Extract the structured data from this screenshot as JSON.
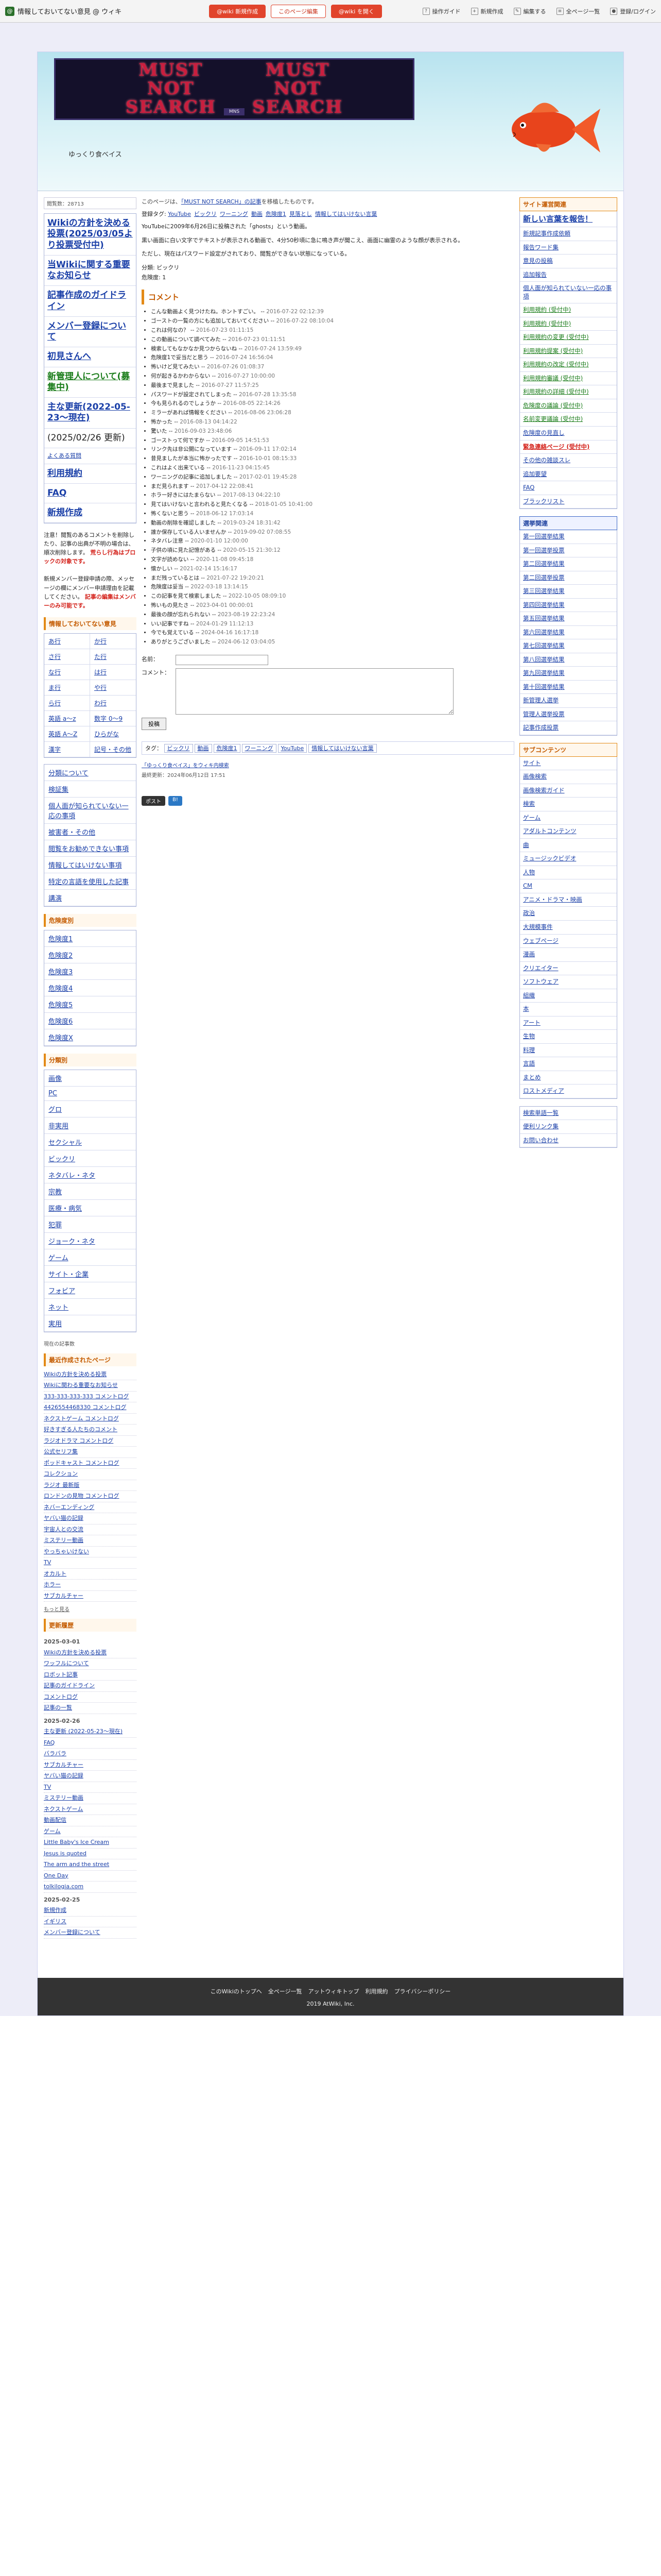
{
  "topbar": {
    "site": "情報しておいてない意見 @ ウィキ",
    "pill1": "@wiki 新規作成",
    "pill2": "このページ編集",
    "pill3": "@wiki を開く",
    "tools": [
      "操作ガイド",
      "新規作成",
      "編集する",
      "全ページ一覧",
      "登録/ログイン"
    ]
  },
  "header": {
    "banner_word1": "MUST\nNOT\nSEARCH",
    "banner_word2": "MUST\nNOT\nSEARCH",
    "banner_badge": "MNS",
    "site_title": "ゆっくり食べイス"
  },
  "left": {
    "views": "閲覧数：28713",
    "bigmenu": [
      "Wikiの方針を決める投票(2025/03/05より投票受付中)",
      "当Wikiに関する重要なお知らせ",
      "記事作成のガイドライン",
      "メンバー登録について",
      "初見さんへ",
      "新管理人について(募集中)",
      "主な更新(2022-05-23〜現在)"
    ],
    "updated": "(2025/02/26 更新)",
    "meta_links": [
      "よくある質問",
      "利用規約",
      "FAQ",
      "新規作成"
    ],
    "notice_a": "注意！閲覧のあるコメントを削除したり、記事の出典が不明の場合は、順次削除します。",
    "notice_warn": "荒らし行為はブロックの対象です。",
    "notice_b": "新規メンバー登録申請の際、メッセージの欄にメンバー申請理由を記載してください。",
    "red_note": "記事の編集はメンバーのみ可能です。",
    "sec_head_1": "情報しておいてない意見",
    "grid": [
      "あ行",
      "か行",
      "さ行",
      "た行",
      "な行",
      "は行",
      "ま行",
      "や行",
      "ら行",
      "わ行",
      "英語 a〜z",
      "数字 0〜9",
      "英語 A〜Z",
      "ひらがな",
      "漢字",
      "記号・その他"
    ],
    "box2": [
      "分類について",
      "検証集",
      "個人面が知られていない一応の事項",
      "被害者・その他",
      "閲覧をお勧めできない事項",
      "情報してはいけない事項",
      "特定の言語を使用した記事",
      "講演"
    ],
    "sec_head_2": "危険度別",
    "danger": [
      "危険度1",
      "危険度2",
      "危険度3",
      "危険度4",
      "危険度5",
      "危険度6",
      "危険度X"
    ],
    "sec_head_3": "分類別",
    "categories": [
      "画像",
      "PC",
      "グロ",
      "非実用",
      "セクシャル",
      "ビックリ",
      "ネタバレ・ネタ",
      "宗教",
      "医療・病気",
      "犯罪",
      "ジョーク・ネタ",
      "ゲーム",
      "サイト・企業",
      "フォビア",
      "ネット",
      "実用"
    ],
    "count": "現在の記事数",
    "sec_head_4": "最近作成されたページ",
    "recent": [
      {
        "t": "Wikiの方針を決める投票"
      },
      {
        "t": "Wikiに関わる重要なお知らせ"
      },
      {
        "t": "333-333-333-333 コメントログ"
      },
      {
        "t": "4426554468330 コメントログ"
      },
      {
        "t": "ネクストゲーム コメントログ"
      },
      {
        "t": "好きすぎる人たちのコメント"
      },
      {
        "t": "ラジオドラマ コメントログ"
      },
      {
        "t": "公式セリフ集"
      },
      {
        "t": "ポッドキャスト コメントログ"
      },
      {
        "t": "コレクション"
      },
      {
        "t": "ラジオ 最新版"
      },
      {
        "t": "ロンドンの見物 コメントログ"
      },
      {
        "t": "ネバーエンディング"
      },
      {
        "t": "ヤバい猫の記録"
      },
      {
        "t": "宇宙人との交流"
      },
      {
        "t": "ミステリー動画"
      },
      {
        "t": "やっちゃいけない"
      },
      {
        "t": "TV"
      },
      {
        "t": "オカルト"
      },
      {
        "t": "ホラー"
      },
      {
        "t": "サブカルチャー"
      }
    ],
    "more": "もっと見る",
    "sec_head_5": "更新履歴",
    "history": [
      {
        "date": "2025-03-01"
      },
      {
        "t": "Wikiの方針を決める投票"
      },
      {
        "t": "ワッフルについて"
      },
      {
        "t": "ロボット記事"
      },
      {
        "t": "記事のガイドライン"
      },
      {
        "t": "コメントログ"
      },
      {
        "t": "記事の一覧"
      },
      {
        "date": "2025-02-26"
      },
      {
        "t": "主な更新 (2022-05-23〜現在)"
      },
      {
        "t": "FAQ"
      },
      {
        "t": "バラバラ"
      },
      {
        "t": "サブカルチャー"
      },
      {
        "t": "ヤバい猫の記録"
      },
      {
        "t": "TV"
      },
      {
        "t": "ミステリー動画"
      },
      {
        "t": "ネクストゲーム"
      },
      {
        "t": "動画配信"
      },
      {
        "t": "ゲーム"
      },
      {
        "t": "Little Baby's Ice Cream"
      },
      {
        "t": "Jesus is quoted"
      },
      {
        "t": "The arm and the street"
      },
      {
        "t": "One Day"
      },
      {
        "t": "tolkilogia.com"
      },
      {
        "date": "2025-02-25"
      },
      {
        "t": "新規作成"
      },
      {
        "t": "イギリス"
      },
      {
        "t": "メンバー登録について"
      }
    ]
  },
  "main": {
    "crumb_1": "このページは、",
    "crumb_link": "「MUST NOT SEARCH」の記事",
    "crumb_2": "を移植したものです。",
    "cat_label": "登録タグ: ",
    "cats": [
      "YouTube",
      "ビックリ",
      "ワーニング",
      "動画",
      "危険度1",
      "見落とし",
      "情報してはいけない言葉"
    ],
    "p1": "YouTubeに2009年6月26日に投稿された「ghosts」という動画。",
    "p2": "黒い画面に白い文字でテキストが表示される動画で、4分50秒頃に急に鳴き声が聞こえ、画面に幽霊のような顔が表示される。",
    "p3": "ただし、現在はパスワード設定がされており、閲覧ができない状態になっている。",
    "cat2": "分類: ビックリ",
    "danger2": "危険度: 1",
    "comment_head": "コメント",
    "comments": [
      {
        "t": "こんな動画よく見つけたね。ホントすごい。",
        "d": "2016-07-22 02:12:39"
      },
      {
        "t": "ゴーストの一覧の方にも追加しておいてください",
        "d": "2016-07-22 08:10:04"
      },
      {
        "t": "これは何なの？",
        "d": "2016-07-23 01:11:15"
      },
      {
        "t": "この動画について調べてみた",
        "d": "2016-07-23 01:11:51"
      },
      {
        "t": "検索してもなかなか見つからないね",
        "d": "2016-07-24 13:59:49"
      },
      {
        "t": "危険度1で妥当だと思う",
        "d": "2016-07-24 16:56:04"
      },
      {
        "t": "怖いけど見てみたい",
        "d": "2016-07-26 01:08:37"
      },
      {
        "t": "何が起きるかわからない",
        "d": "2016-07-27 10:00:00"
      },
      {
        "t": "最後まで見ました",
        "d": "2016-07-27 11:57:25"
      },
      {
        "t": "パスワードが設定されてしまった",
        "d": "2016-07-28 13:35:58"
      },
      {
        "t": "今も見られるのでしょうか",
        "d": "2016-08-05 22:14:26"
      },
      {
        "t": "ミラーがあれば情報をください",
        "d": "2016-08-06 23:06:28"
      },
      {
        "t": "怖かった",
        "d": "2016-08-13 04:14:22"
      },
      {
        "t": "驚いた",
        "d": "2016-09-03 23:48:06"
      },
      {
        "t": "ゴーストって何ですか",
        "d": "2016-09-05 14:51:53"
      },
      {
        "t": "リンク先は非公開になっています",
        "d": "2016-09-11 17:02:14"
      },
      {
        "t": "昔見ましたが本当に怖かったです",
        "d": "2016-10-01 08:15:33"
      },
      {
        "t": "これはよく出来ている",
        "d": "2016-11-23 04:15:45"
      },
      {
        "t": "ワーニングの記事に追加しました",
        "d": "2017-02-01 19:45:28"
      },
      {
        "t": "まだ見られます",
        "d": "2017-04-12 22:08:41"
      },
      {
        "t": "ホラー好きにはたまらない",
        "d": "2017-08-13 04:22:10"
      },
      {
        "t": "見てはいけないと言われると見たくなる",
        "d": "2018-01-05 10:41:00"
      },
      {
        "t": "怖くないと思う",
        "d": "2018-06-12 17:03:14"
      },
      {
        "t": "動画の削除を確認しました",
        "d": "2019-03-24 18:31:42"
      },
      {
        "t": "誰か保存している人いませんか",
        "d": "2019-09-02 07:08:55"
      },
      {
        "t": "ネタバレ注意",
        "d": "2020-01-10 12:00:00"
      },
      {
        "t": "子供の頃に見た記憶がある",
        "d": "2020-05-15 21:30:12"
      },
      {
        "t": "文字が読めない",
        "d": "2020-11-08 09:45:18"
      },
      {
        "t": "懐かしい",
        "d": "2021-02-14 15:16:17"
      },
      {
        "t": "まだ残っているとは",
        "d": "2021-07-22 19:20:21"
      },
      {
        "t": "危険度は妥当",
        "d": "2022-03-18 13:14:15"
      },
      {
        "t": "この記事を見て検索しました",
        "d": "2022-10-05 08:09:10"
      },
      {
        "t": "怖いもの見たさ",
        "d": "2023-04-01 00:00:01"
      },
      {
        "t": "最後の顔が忘れられない",
        "d": "2023-08-19 22:23:24"
      },
      {
        "t": "いい記事ですね",
        "d": "2024-01-29 11:12:13"
      },
      {
        "t": "今でも覚えている",
        "d": "2024-04-16 16:17:18"
      },
      {
        "t": "ありがとうございました",
        "d": "2024-06-12 03:04:05"
      }
    ],
    "form_name": "名前：",
    "form_comment": "コメント：",
    "form_submit": "投稿",
    "tagbar_label": "タグ：",
    "tagbar": [
      "ビックリ",
      "動画",
      "危険度1",
      "ワーニング",
      "YouTube",
      "情報してはいけない言葉"
    ],
    "related": "「ゆっくり食べイス」をウィキ内検索",
    "lastmod": "最終更新：2024年06月12日 17:51",
    "share_tw": "ポスト",
    "share_hb": "B!"
  },
  "right": {
    "head1": "サイト運営関連",
    "list1": [
      {
        "t": "新しい言葉を報告！",
        "big": true
      },
      {
        "t": "新規記事作成依頼"
      },
      {
        "t": "報告ワード集"
      },
      {
        "t": "意見の投稿"
      },
      {
        "t": "追加報告"
      },
      {
        "t": "個人面が知られていない一応の事項"
      },
      {
        "t": "利用規約 (受付中)",
        "g": true
      },
      {
        "t": "利用規約 (受付中)",
        "g": true
      },
      {
        "t": "利用規約の変更 (受付中)",
        "g": true
      },
      {
        "t": "利用規約提案 (受付中)",
        "g": true
      },
      {
        "t": "利用規約の改定 (受付中)",
        "g": true
      },
      {
        "t": "利用規約審議 (受付中)",
        "g": true
      },
      {
        "t": "利用規約の詳細 (受付中)",
        "g": true
      },
      {
        "t": "危険度の議論 (受付中)",
        "g": true
      },
      {
        "t": "名前変更議論 (受付中)",
        "g": true
      },
      {
        "t": "危険度の見直し"
      },
      {
        "t": "緊急連絡ページ (受付中)",
        "r": true
      },
      {
        "t": "その他の雑談スレ"
      },
      {
        "t": "追加要望"
      },
      {
        "t": "FAQ"
      },
      {
        "t": "ブラックリスト"
      }
    ],
    "head2": "選挙関連",
    "list2": [
      {
        "t": "第一回選挙結果"
      },
      {
        "t": "第一回選挙投票"
      },
      {
        "t": "第二回選挙結果"
      },
      {
        "t": "第二回選挙投票"
      },
      {
        "t": "第三回選挙結果"
      },
      {
        "t": "第四回選挙結果"
      },
      {
        "t": "第五回選挙結果"
      },
      {
        "t": "第六回選挙結果"
      },
      {
        "t": "第七回選挙結果"
      },
      {
        "t": "第八回選挙結果"
      },
      {
        "t": "第九回選挙結果"
      },
      {
        "t": "第十回選挙結果"
      },
      {
        "t": "新管理人選挙"
      },
      {
        "t": "管理人選挙投票"
      },
      {
        "t": "記事作成投票"
      }
    ],
    "head3": "サブコンテンツ",
    "list3": [
      {
        "t": "サイト"
      },
      {
        "t": "画像検索"
      },
      {
        "t": "画像検索ガイド"
      },
      {
        "t": "検索"
      },
      {
        "t": "ゲーム"
      },
      {
        "t": "アダルトコンテンツ"
      },
      {
        "t": "曲"
      },
      {
        "t": "ミュージックビデオ"
      },
      {
        "t": "人物"
      },
      {
        "t": "CM"
      },
      {
        "t": "アニメ・ドラマ・映画"
      },
      {
        "t": "政治"
      },
      {
        "t": "大規模事件"
      },
      {
        "t": "ウェブページ"
      },
      {
        "t": "漫画"
      },
      {
        "t": "クリエイター"
      },
      {
        "t": "ソフトウェア"
      },
      {
        "t": "組織"
      },
      {
        "t": "本"
      },
      {
        "t": "アート"
      },
      {
        "t": "生物"
      },
      {
        "t": "料理"
      },
      {
        "t": "言語"
      },
      {
        "t": "まとめ"
      },
      {
        "t": "ロストメディア"
      }
    ],
    "list4": [
      {
        "t": "検索単語一覧"
      },
      {
        "t": "便利リンク集"
      },
      {
        "t": "お問い合わせ"
      }
    ]
  },
  "footer": {
    "links": [
      "このWikiのトップへ",
      "全ページ一覧",
      "アットウィキトップ",
      "利用規約",
      "プライバシーポリシー"
    ],
    "copyright": "2019 AtWiki, Inc."
  }
}
